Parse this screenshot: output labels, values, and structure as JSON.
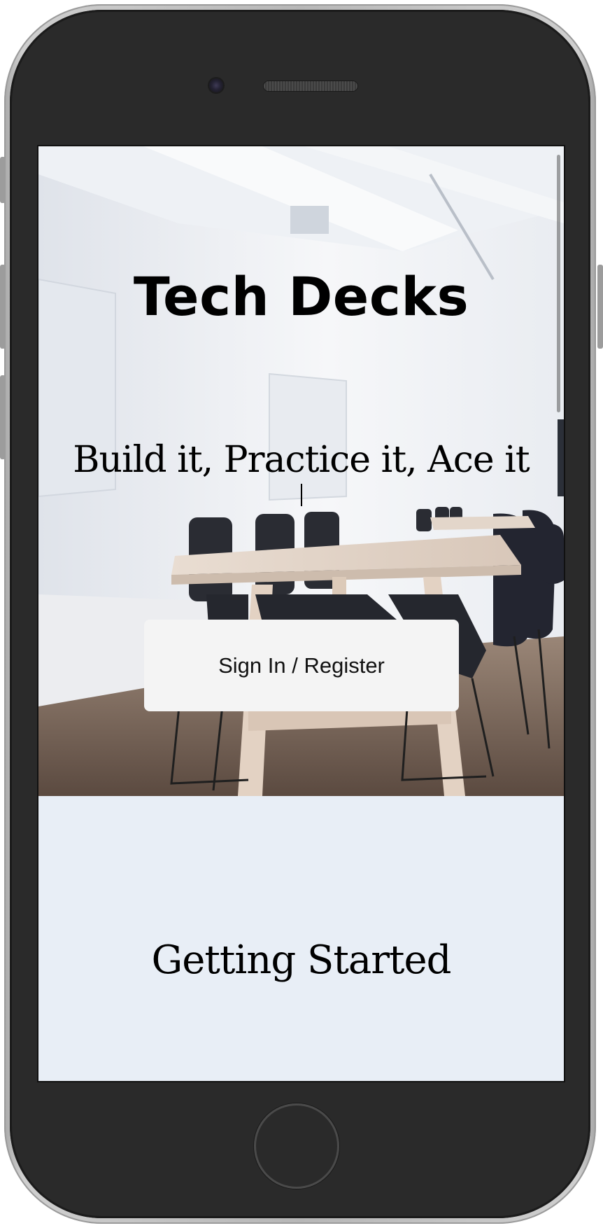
{
  "hero": {
    "title": "Tech Decks",
    "tagline": "Build it, Practice it, Ace it",
    "signin_label": "Sign In / Register"
  },
  "section": {
    "heading": "Getting Started"
  },
  "colors": {
    "section_bg": "#e8eef6",
    "button_bg": "#f4f4f4",
    "device_frame": "#2a2a2a"
  }
}
